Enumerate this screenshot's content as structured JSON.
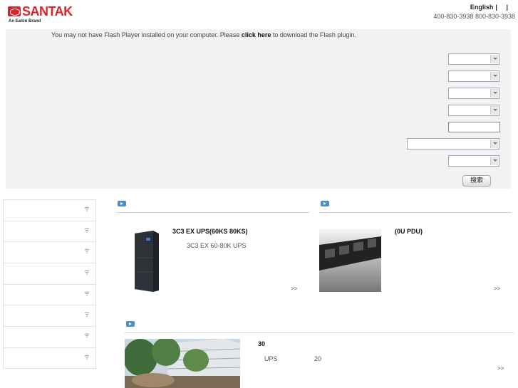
{
  "header": {
    "brand": "SANTAK",
    "brand_sub": "An Eaton Brand",
    "lang_link": "English",
    "sep1": "|",
    "sep2": "|",
    "hotline": "400-830-3938 800-830-3938"
  },
  "flash": {
    "note_prefix": "You may not have Flash Player installed on your computer. Please ",
    "note_link": "click here",
    "note_suffix": " to download the Flash plugin.",
    "search_button": "搜索"
  },
  "sections": [
    {
      "title": "3C3 EX UPS(60KS  80KS)",
      "desc": "3C3 EX 60-80K UPS",
      "more": ">>"
    },
    {
      "title": "(0U PDU)",
      "desc": "",
      "more": ">>"
    },
    {
      "title": "30",
      "desc": "UPS",
      "desc2": "20",
      "more": ">>"
    }
  ],
  "colors": {
    "brand_red": "#d8242c",
    "section_icon": "#4a8fc9"
  }
}
